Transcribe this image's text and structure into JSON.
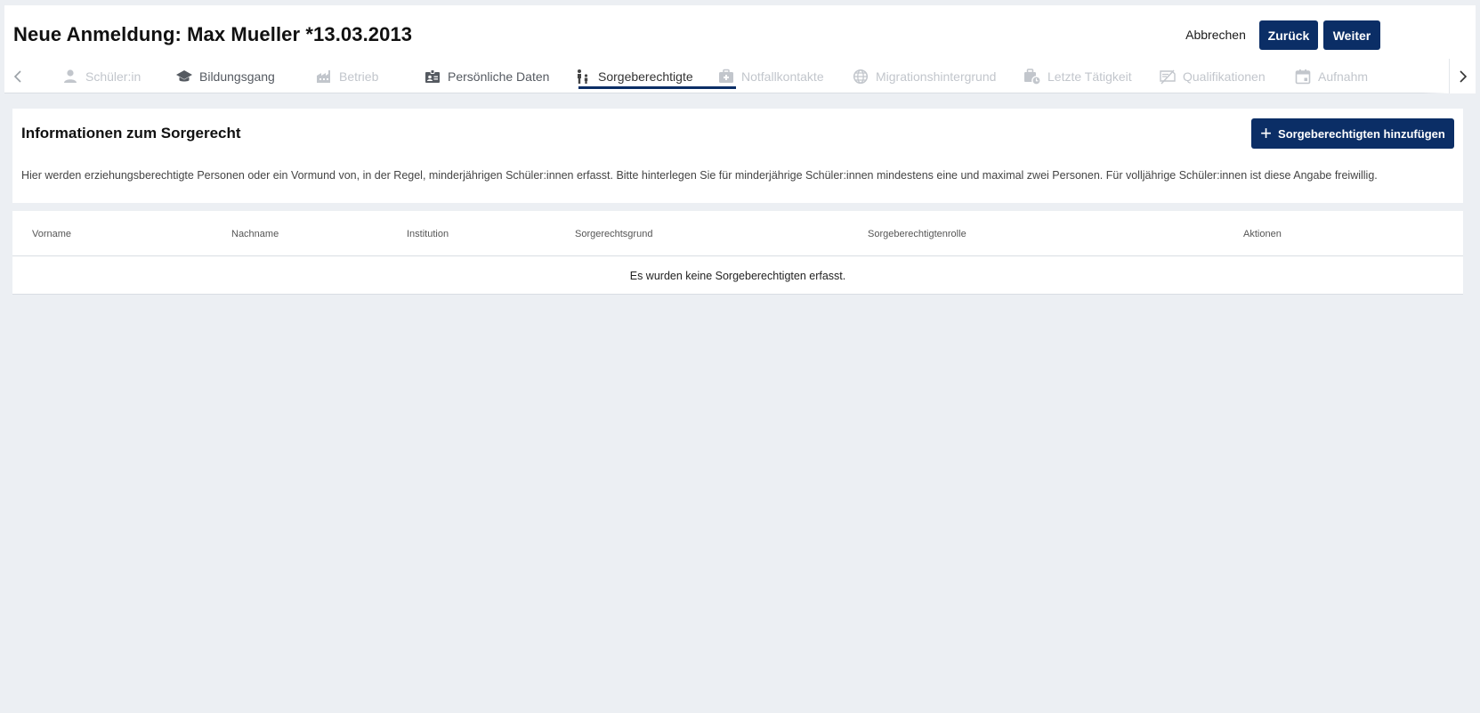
{
  "header": {
    "title": "Neue Anmeldung: Max Mueller *13.03.2013",
    "cancel_label": "Abbrechen",
    "back_label": "Zurück",
    "next_label": "Weiter"
  },
  "tabs": [
    {
      "label": "Schüler:in",
      "icon": "person-icon",
      "state": "disabled"
    },
    {
      "label": "Bildungsgang",
      "icon": "graduation-cap-icon",
      "state": "enabled"
    },
    {
      "label": "Betrieb",
      "icon": "factory-icon",
      "state": "disabled"
    },
    {
      "label": "Persönliche Daten",
      "icon": "id-badge-icon",
      "state": "enabled"
    },
    {
      "label": "Sorgeberechtigte",
      "icon": "family-icon",
      "state": "active"
    },
    {
      "label": "Notfallkontakte",
      "icon": "medical-kit-icon",
      "state": "disabled"
    },
    {
      "label": "Migrationshintergrund",
      "icon": "globe-icon",
      "state": "disabled"
    },
    {
      "label": "Letzte Tätigkeit",
      "icon": "work-history-icon",
      "state": "disabled"
    },
    {
      "label": "Qualifikationen",
      "icon": "certificate-icon",
      "state": "disabled"
    },
    {
      "label": "Aufnahm",
      "icon": "calendar-icon",
      "state": "disabled"
    }
  ],
  "info": {
    "title": "Informationen zum Sorgerecht",
    "add_button_label": "Sorgeberechtigten hinzufügen",
    "description": "Hier werden erziehungsberechtigte Personen oder ein Vormund von, in der Regel, minderjährigen Schüler:innen erfasst. Bitte hinterlegen Sie für minderjährige Schüler:innen mindestens eine und maximal zwei Personen. Für volljährige Schüler:innen ist diese Angabe freiwillig."
  },
  "table": {
    "columns": [
      "Vorname",
      "Nachname",
      "Institution",
      "Sorgerechtsgrund",
      "Sorgeberechtigtenrolle",
      "Aktionen"
    ],
    "empty_message": "Es wurden keine Sorgeberechtigten erfasst."
  },
  "colors": {
    "primary": "#0b2e66",
    "background": "#eceff3",
    "tab_disabled": "#c2c6cc",
    "tab_enabled": "#555a61"
  }
}
